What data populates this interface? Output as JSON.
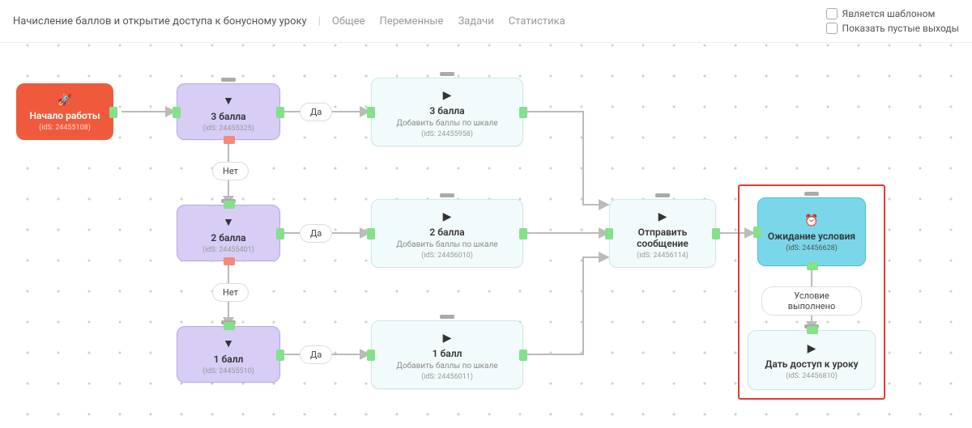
{
  "header": {
    "title": "Начисление баллов и открытие доступа к бонусному уроку",
    "tabs": [
      "Общее",
      "Переменные",
      "Задачи",
      "Статистика"
    ],
    "cb1": "Является шаблоном",
    "cb2": "Показать пустые выходы"
  },
  "nodes": {
    "start": {
      "title": "Начало работы",
      "id": "(idS: 24455108)"
    },
    "cond3": {
      "title": "3 балла",
      "id": "(idS: 24455325)"
    },
    "cond2": {
      "title": "2 балла",
      "id": "(idS: 24455401)"
    },
    "cond1": {
      "title": "1 балл",
      "id": "(idS: 24455510)"
    },
    "add3": {
      "title": "3 балла",
      "sub": "Добавить баллы по шкале",
      "id": "(idS: 24455958)"
    },
    "add2": {
      "title": "2 балла",
      "sub": "Добавить баллы по шкале",
      "id": "(idS: 24456010)"
    },
    "add1": {
      "title": "1 балл",
      "sub": "Добавить баллы по шкале",
      "id": "(idS: 24456011)"
    },
    "send": {
      "title": "Отправить сообщение",
      "id": "(idS: 24456114)"
    },
    "wait": {
      "title": "Ожидание условия",
      "id": "(idS: 24456628)"
    },
    "grant": {
      "title": "Дать доступ к уроку",
      "id": "(idS: 24456810)"
    }
  },
  "labels": {
    "yes": "Да",
    "no": "Нет",
    "cond_done": "Условие выполнено"
  }
}
